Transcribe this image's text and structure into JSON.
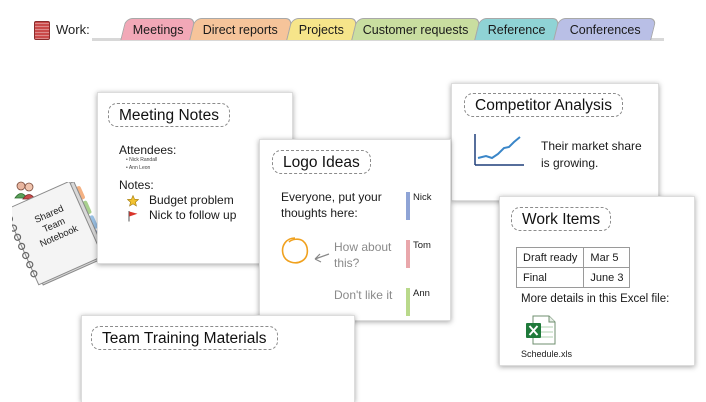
{
  "notebook": {
    "label": "Work:",
    "tabs": [
      {
        "label": "Meetings",
        "color": "#f2a8b7"
      },
      {
        "label": "Direct reports",
        "color": "#f6c49a"
      },
      {
        "label": "Projects",
        "color": "#f6e58a"
      },
      {
        "label": "Customer requests",
        "color": "#c9dea0"
      },
      {
        "label": "Reference",
        "color": "#8fd3d5"
      },
      {
        "label": "Conferences",
        "color": "#b9bfe6"
      }
    ]
  },
  "shared_notebook": {
    "line1": "Shared",
    "line2": "Team",
    "line3": "Notebook"
  },
  "meeting_notes": {
    "title": "Meeting Notes",
    "attendees_label": "Attendees:",
    "attendees": [
      "Nick Randall",
      "Ann Leon"
    ],
    "notes_label": "Notes:",
    "notes": [
      "Budget problem",
      "Nick to follow up"
    ]
  },
  "logo_ideas": {
    "title": "Logo Ideas",
    "prompt_line1": "Everyone, put your",
    "prompt_line2": "thoughts here:",
    "question_line1": "How about",
    "question_line2": "this?",
    "reply": "Don't like it",
    "authors": [
      {
        "name": "Nick",
        "color": "#8fa4d6"
      },
      {
        "name": "Tom",
        "color": "#e9a7ab"
      },
      {
        "name": "Ann",
        "color": "#b9d98b"
      }
    ]
  },
  "competitor": {
    "title": "Competitor Analysis",
    "text_line1": "Their market share",
    "text_line2": "is growing."
  },
  "work_items": {
    "title": "Work Items",
    "rows": [
      [
        "Draft ready",
        "Mar 5"
      ],
      [
        "Final",
        "June 3"
      ]
    ],
    "details": "More details in this Excel file:",
    "file_name": "Schedule.xls"
  },
  "training": {
    "title": "Team Training Materials"
  }
}
